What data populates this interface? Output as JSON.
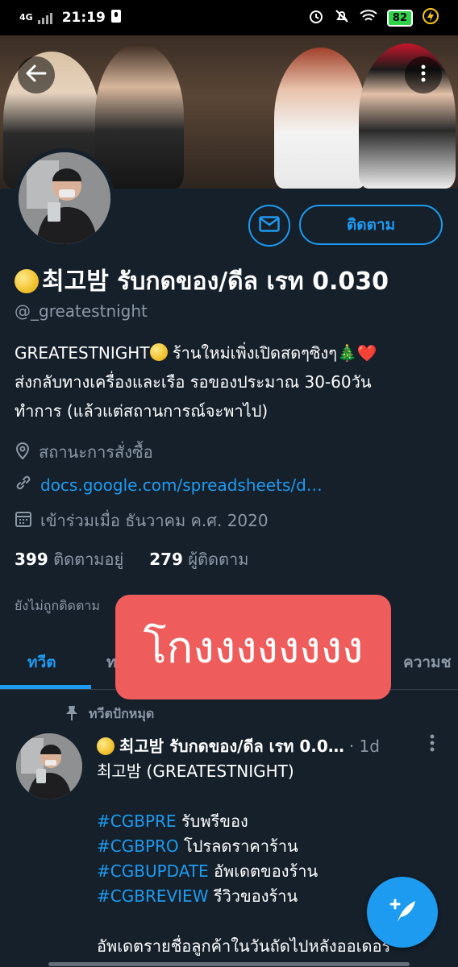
{
  "status_bar": {
    "network": "4G",
    "time": "21:19",
    "battery": "82"
  },
  "colors": {
    "accent": "#1d9bf0",
    "background": "#15202b",
    "overlay": "#ee5d5c",
    "muted": "#8b98a5"
  },
  "icons": [
    "back-arrow-icon",
    "more-vertical-icon",
    "mail-icon",
    "location-icon",
    "link-icon",
    "calendar-icon",
    "pin-icon",
    "compose-tweet-icon"
  ],
  "profile": {
    "display_name": "최고밤 รับกดของ/ดีล เรท 0.030",
    "handle": "@_greatestnight",
    "follow_label": "ติดตาม",
    "bio_line1_a": "GREATESTNIGHT",
    "bio_line1_b": " ร้านใหม่เพิ่งเปิดสดๆซิงๆ🎄❤️",
    "bio_line2": "ส่งกลับทางเครื่องและเรือ รอของประมาณ 30-60วัน",
    "bio_line3": "ทำการ (แล้วแต่สถานการณ์จะพาไป)",
    "location": "สถานะการสั่งซื้อ",
    "link": "docs.google.com/spreadsheets/d…",
    "joined": "เข้าร่วมเมื่อ ธันวาคม ค.ศ. 2020",
    "following_count": "399",
    "following_label": "ติดตามอยู่",
    "followers_count": "279",
    "followers_label": "ผู้ติดตาม",
    "not_followed": "ยังไม่ถูกติดตาม"
  },
  "tabs": [
    {
      "label": "ทวีต"
    },
    {
      "label": "ท"
    },
    {
      "label": "ความช"
    }
  ],
  "overlay_text": "โกงงงงงงงง",
  "tweet": {
    "pinned_label": "ทวีตปักหมุด",
    "author": "최고밤 รับกดของ/ดีล เรท 0.0…",
    "time": "· 1d",
    "line1": "최고밤 (GREATESTNIGHT)",
    "tags": [
      {
        "tag": "#CGBPRE",
        "text": " รับพรีของ"
      },
      {
        "tag": "#CGBPRO",
        "text": " โปรลดราคาร้าน"
      },
      {
        "tag": "#CGBUPDATE",
        "text": " อัพเดตของร้าน"
      },
      {
        "tag": "#CGBREVIEW",
        "text": " รีวิวของร้าน"
      }
    ],
    "last_line": "อัพเดตรายชื่อลูกค้าในวันถัดไปหลังออเดอร์"
  }
}
